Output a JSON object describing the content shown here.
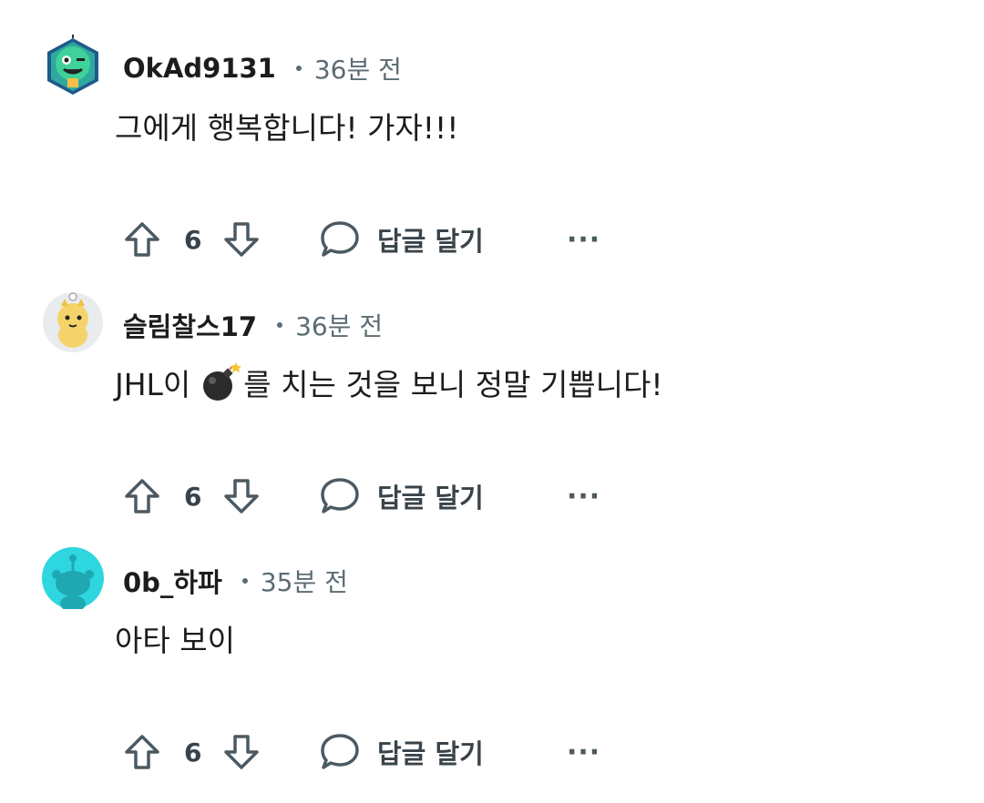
{
  "comments": [
    {
      "username": "OkAd9131",
      "time": "36분 전",
      "body": "그에게 행복합니다! 가자!!!",
      "score": "6",
      "reply_label": "답글 달기",
      "more_label": "···",
      "avatar": "green-snoo-monster-avatar"
    },
    {
      "username": "슬림찰스17",
      "time": "36분 전",
      "body_before": "JHL이",
      "body_after": "를 치는 것을 보니 정말 기쁩니다!",
      "emoji": "bomb-icon",
      "score": "6",
      "reply_label": "답글 달기",
      "more_label": "···",
      "avatar": "yellow-tiger-snoo-avatar"
    },
    {
      "username": "0b_하파",
      "time": "35분 전",
      "body": "아타 보이",
      "score": "6",
      "reply_label": "답글 달기",
      "more_label": "···",
      "avatar": "default-cyan-snoo-avatar"
    }
  ],
  "colors": {
    "text": "#1c1c1c",
    "meta": "#5c6c74",
    "action": "#4b5a62",
    "avatar_cyan": "#2ed6e0",
    "avatar_green": "#2fbf9a"
  }
}
